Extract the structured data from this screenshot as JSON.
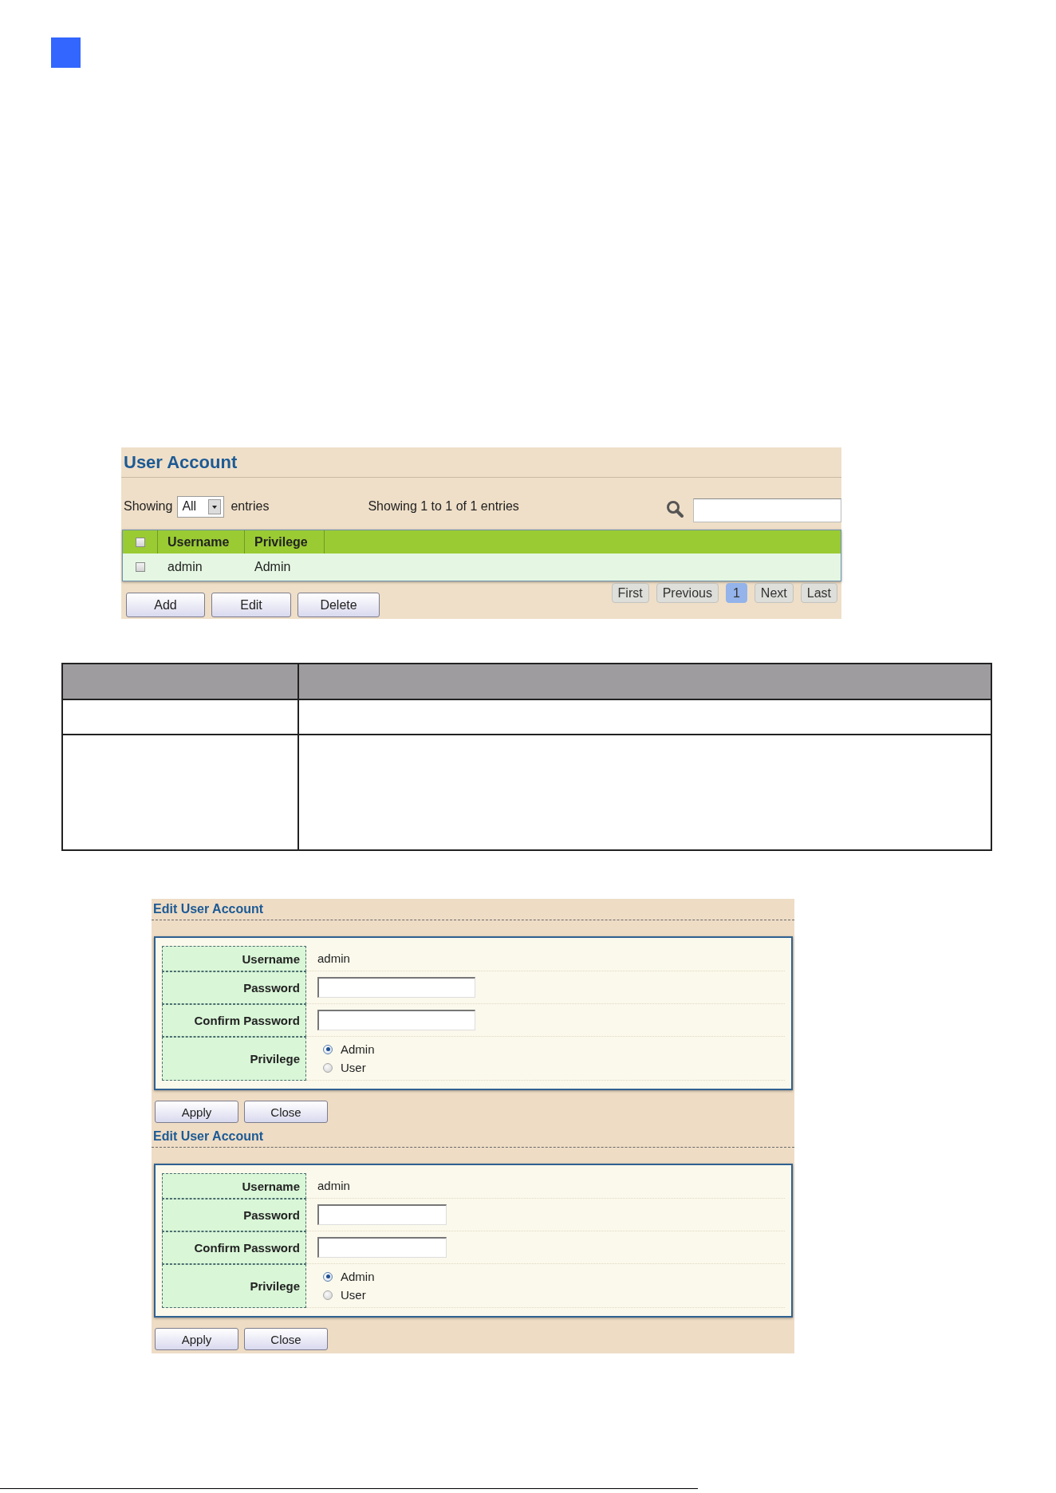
{
  "user_account": {
    "title": "User Account",
    "showing_label": "Showing",
    "page_size": "All",
    "entries_label": "entries",
    "info": "Showing 1 to 1 of 1 entries",
    "table": {
      "header_checked": false,
      "columns": [
        "Username",
        "Privilege"
      ],
      "rows": [
        {
          "checked": false,
          "cells": [
            "admin",
            "Admin"
          ]
        }
      ]
    },
    "buttons": [
      "Add",
      "Edit",
      "Delete"
    ],
    "pagination": [
      {
        "label": "First",
        "selected": false
      },
      {
        "label": "Previous",
        "selected": false
      },
      {
        "label": "1",
        "selected": true
      },
      {
        "label": "Next",
        "selected": false
      },
      {
        "label": "Last",
        "selected": false
      }
    ]
  },
  "edit_panels": [
    {
      "title": "Edit User Account",
      "fields": [
        {
          "kind": "text",
          "label": "Username",
          "value": "admin"
        },
        {
          "kind": "password",
          "label": "Password"
        },
        {
          "kind": "password",
          "label": "Confirm Password"
        },
        {
          "kind": "radio",
          "label": "Privilege",
          "options": [
            {
              "label": "Admin",
              "selected": true
            },
            {
              "label": "User",
              "selected": false
            }
          ]
        }
      ],
      "buttons": [
        "Apply",
        "Close"
      ]
    },
    {
      "title": "Edit User Account",
      "fields": [
        {
          "kind": "text",
          "label": "Username",
          "value": "admin"
        },
        {
          "kind": "password",
          "label": "Password"
        },
        {
          "kind": "password",
          "label": "Confirm Password"
        },
        {
          "kind": "radio",
          "label": "Privilege",
          "options": [
            {
              "label": "Admin",
              "selected": true
            },
            {
              "label": "User",
              "selected": false
            }
          ]
        }
      ],
      "buttons": [
        "Apply",
        "Close"
      ]
    }
  ]
}
